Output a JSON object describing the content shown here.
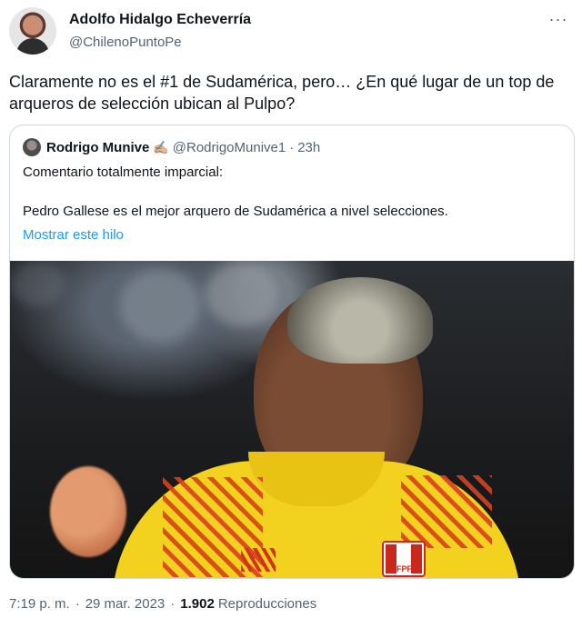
{
  "author": {
    "name": "Adolfo Hidalgo Echeverría",
    "handle": "@ChilenoPuntoPe"
  },
  "tweet_text": "Claramente no es el #1 de Sudamérica, pero… ¿En qué lugar de un top de arqueros de selección ubican al Pulpo?",
  "quote": {
    "name": "Rodrigo Munive",
    "emoji": "✍🏼",
    "handle": "@RodrigoMunive1",
    "separator": "·",
    "time": "23h",
    "line1": "Comentario totalmente imparcial:",
    "line2": "Pedro Gallese es el mejor arquero de Sudamérica a nivel selecciones.",
    "show_thread": "Mostrar este hilo",
    "crest_text": "FPF"
  },
  "footer": {
    "time": "7:19 p. m.",
    "sep1": "·",
    "date": "29 mar. 2023",
    "sep2": "·",
    "views_count": "1.902",
    "views_label": "Reproducciones"
  },
  "icons": {
    "more": "more-horizontal-icon"
  }
}
